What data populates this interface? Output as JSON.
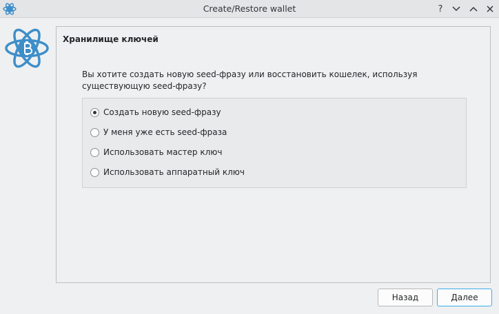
{
  "window": {
    "title": "Create/Restore wallet",
    "help_glyph": "?",
    "minimize_glyph": "⌄",
    "maximize_glyph": "⌃"
  },
  "page": {
    "heading": "Хранилище ключей",
    "question": "Вы хотите создать новую seed-фразу или восстановить кошелек, используя существующую seed-фразу?"
  },
  "options": [
    {
      "label": "Создать новую seed-фразу",
      "selected": true
    },
    {
      "label": "У меня уже есть seed-фраза",
      "selected": false
    },
    {
      "label": "Использовать мастер ключ",
      "selected": false
    },
    {
      "label": "Использовать аппаратный ключ",
      "selected": false
    }
  ],
  "buttons": {
    "back": "Назад",
    "next": "Далее"
  },
  "colors": {
    "accent": "#3daee9",
    "logo": "#3d8ec9"
  },
  "icons": {
    "app": "electrum-logo-icon",
    "logo": "electrum-logo-icon"
  }
}
